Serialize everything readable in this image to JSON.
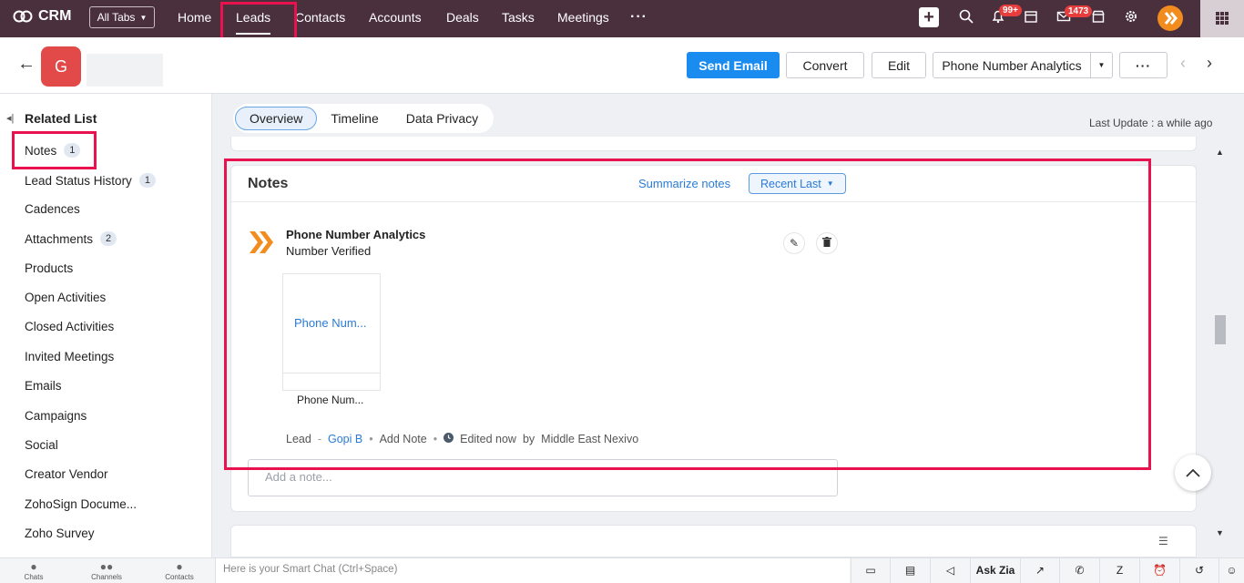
{
  "app": {
    "name": "CRM"
  },
  "nav": {
    "all_tabs": "All Tabs",
    "links": [
      "Home",
      "Leads",
      "Contacts",
      "Accounts",
      "Deals",
      "Tasks",
      "Meetings"
    ],
    "notif_badge": "99+",
    "mail_badge": "1473"
  },
  "record": {
    "avatar_letter": "G",
    "buttons": {
      "send_email": "Send Email",
      "convert": "Convert",
      "edit": "Edit",
      "phone_analytics": "Phone Number Analytics"
    }
  },
  "sidebar": {
    "title": "Related List",
    "items": [
      {
        "label": "Notes",
        "count": "1"
      },
      {
        "label": "Lead Status History",
        "count": "1"
      },
      {
        "label": "Cadences"
      },
      {
        "label": "Attachments",
        "count": "2"
      },
      {
        "label": "Products"
      },
      {
        "label": "Open Activities"
      },
      {
        "label": "Closed Activities"
      },
      {
        "label": "Invited Meetings"
      },
      {
        "label": "Emails"
      },
      {
        "label": "Campaigns"
      },
      {
        "label": "Social"
      },
      {
        "label": "Creator Vendor"
      },
      {
        "label": "ZohoSign Docume..."
      },
      {
        "label": "Zoho Survey"
      }
    ]
  },
  "tabs": [
    "Overview",
    "Timeline",
    "Data Privacy"
  ],
  "last_update": "Last Update : a while ago",
  "notes": {
    "title": "Notes",
    "summarize": "Summarize notes",
    "sort": "Recent Last",
    "note": {
      "title": "Phone Number Analytics",
      "body": "Number Verified",
      "attachment_link": "Phone Num...",
      "attachment_name": "Phone Num...",
      "meta": {
        "module": "Lead",
        "owner": "Gopi B",
        "add_note": "Add Note",
        "edited": "Edited now",
        "by": "by",
        "author": "Middle East Nexivo"
      }
    },
    "add_placeholder": "Add a note..."
  },
  "footer": {
    "chats": "Chats",
    "channels": "Channels",
    "contacts": "Contacts",
    "smart_chat": "Here is your Smart Chat (Ctrl+Space)",
    "ask_zia": "Ask Zia"
  },
  "colors": {
    "nav_bg": "#4a2f3d",
    "primary": "#1a8cf0",
    "highlight": "#e8124f",
    "brand_orange": "#f28c1e"
  }
}
